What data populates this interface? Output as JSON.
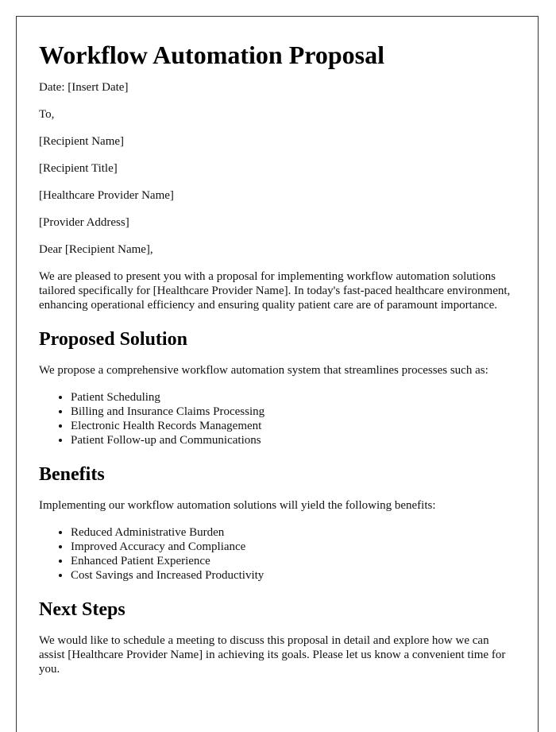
{
  "document": {
    "title": "Workflow Automation Proposal",
    "date_line": "Date: [Insert Date]",
    "to_line": "To,",
    "recipient_name": "[Recipient Name]",
    "recipient_title": "[Recipient Title]",
    "provider_name": "[Healthcare Provider Name]",
    "provider_address": "[Provider Address]",
    "salutation": "Dear [Recipient Name],",
    "intro": "We are pleased to present you with a proposal for implementing workflow automation solutions tailored specifically for [Healthcare Provider Name]. In today's fast-paced healthcare environment, enhancing operational efficiency and ensuring quality patient care are of paramount importance."
  },
  "sections": {
    "proposed_solution": {
      "heading": "Proposed Solution",
      "intro": "We propose a comprehensive workflow automation system that streamlines processes such as:",
      "items": [
        "Patient Scheduling",
        "Billing and Insurance Claims Processing",
        "Electronic Health Records Management",
        "Patient Follow-up and Communications"
      ]
    },
    "benefits": {
      "heading": "Benefits",
      "intro": "Implementing our workflow automation solutions will yield the following benefits:",
      "items": [
        "Reduced Administrative Burden",
        "Improved Accuracy and Compliance",
        "Enhanced Patient Experience",
        "Cost Savings and Increased Productivity"
      ]
    },
    "next_steps": {
      "heading": "Next Steps",
      "body": "We would like to schedule a meeting to discuss this proposal in detail and explore how we can assist [Healthcare Provider Name] in achieving its goals. Please let us know a convenient time for you."
    }
  }
}
